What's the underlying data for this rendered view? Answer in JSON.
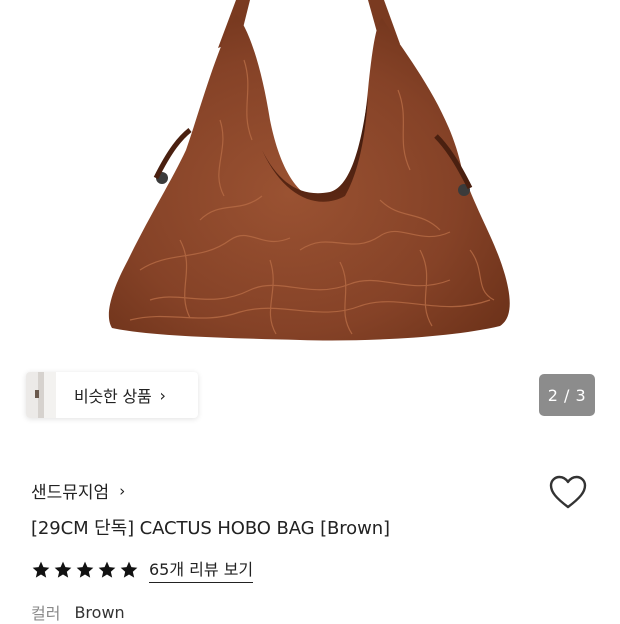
{
  "hero": {
    "image_alt": "Brown patchwork leather hobo bag",
    "similar_products_label": "비슷한 상품",
    "page_indicator": "2 / 3"
  },
  "product": {
    "brand": "샌드뮤지엄",
    "title": "[29CM 단독] CACTUS HOBO BAG [Brown]",
    "rating_stars": 5,
    "review_link": "65개 리뷰 보기",
    "color_label": "컬러",
    "color_value": "Brown"
  },
  "icons": {
    "chevron": "chevron-right-icon",
    "wishlist": "heart-outline-icon",
    "star": "star-filled-icon"
  },
  "colors": {
    "leather": "#8a4428",
    "indicator_bg": "#8c8c8c",
    "text": "#222222",
    "muted": "#8a8a8a"
  }
}
